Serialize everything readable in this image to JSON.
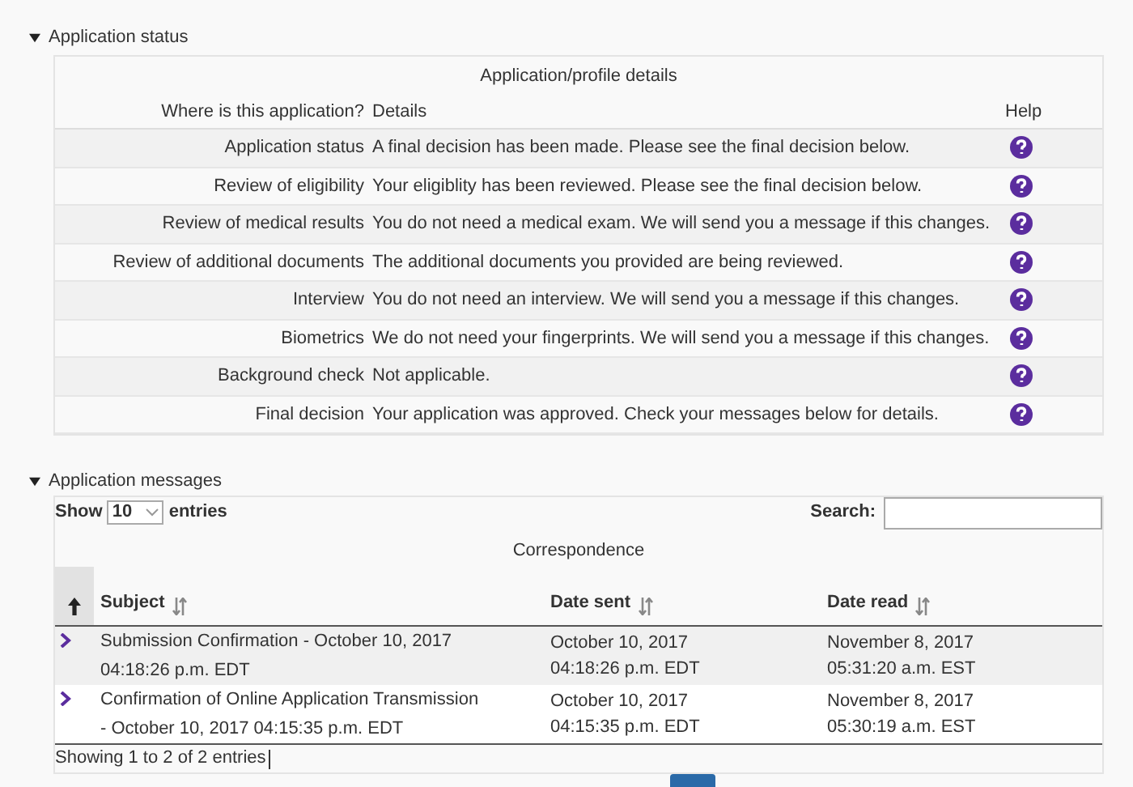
{
  "status_section": {
    "title": "Application status",
    "expanded": true,
    "caption": "Application/profile details",
    "columns": [
      "Where is this application?",
      "Details",
      "Help"
    ],
    "rows": [
      {
        "stage": "Application status",
        "details": "A final decision has been made. Please see the final decision below."
      },
      {
        "stage": "Review of eligibility",
        "details": "Your eligiblity has been reviewed. Please see the final decision below."
      },
      {
        "stage": "Review of medical results",
        "details": "You do not need a medical exam. We will send you a message if this changes."
      },
      {
        "stage": "Review of additional documents",
        "details": "The additional documents you provided are being reviewed."
      },
      {
        "stage": "Interview",
        "details": "You do not need an interview. We will send you a message if this changes."
      },
      {
        "stage": "Biometrics",
        "details": "We do not need your fingerprints. We will send you a message if this changes."
      },
      {
        "stage": "Background check",
        "details": "Not applicable."
      },
      {
        "stage": "Final decision",
        "details": "Your application was approved. Check your messages below for details."
      }
    ]
  },
  "messages_section": {
    "title": "Application messages",
    "expanded": true,
    "show_label": "Show",
    "page_size": "10",
    "entries_label": "entries",
    "search_label": "Search:",
    "caption": "Correspondence",
    "columns": [
      {
        "label": "Subject"
      },
      {
        "label": "Date sent"
      },
      {
        "label": "Date read"
      }
    ],
    "rows": [
      {
        "subject": [
          "Submission Confirmation - October 10, 2017",
          "04:18:26 p.m. EDT"
        ],
        "sent": [
          "October 10, 2017",
          "04:18:26 p.m. EDT"
        ],
        "read": [
          "November 8, 2017",
          "05:31:20 a.m. EST"
        ]
      },
      {
        "subject": [
          "Confirmation of Online Application Transmission",
          "- October 10, 2017 04:15:35 p.m. EDT"
        ],
        "sent": [
          "October 10, 2017",
          "04:15:35 p.m. EDT"
        ],
        "read": [
          "November 8, 2017",
          "05:30:19 a.m. EST"
        ]
      }
    ],
    "footer": "Showing 1 to 2 of 2 entries"
  }
}
